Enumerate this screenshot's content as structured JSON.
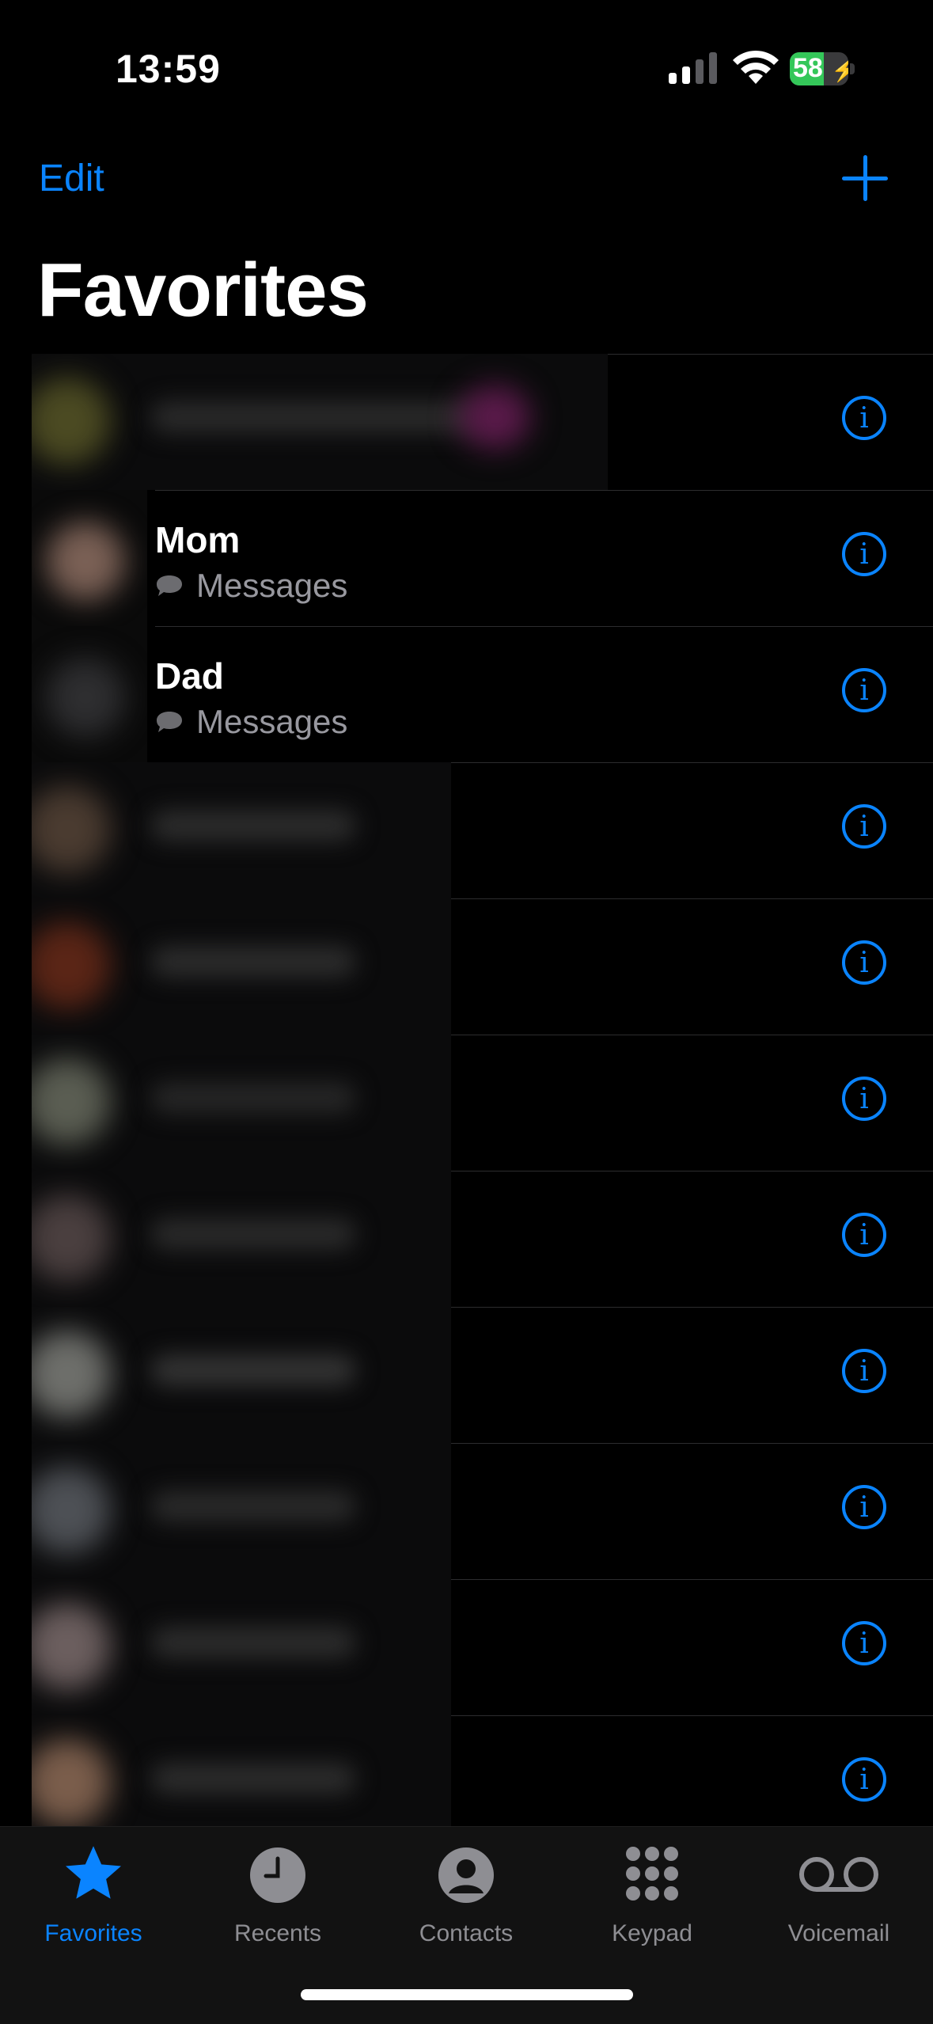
{
  "status_bar": {
    "time": "13:59",
    "battery_level": "58",
    "battery_percent_value": 58,
    "battery_color": "#34c759"
  },
  "header": {
    "edit_label": "Edit",
    "add_icon": "plus-icon",
    "title": "Favorites"
  },
  "accent_color": "#0a84ff",
  "favorites": [
    {
      "name": "",
      "subtitle": "",
      "blurred": true
    },
    {
      "name": "Mom",
      "subtitle": "Messages",
      "blurred": false
    },
    {
      "name": "Dad",
      "subtitle": "Messages",
      "blurred": false
    },
    {
      "name": "",
      "subtitle": "",
      "blurred": true
    },
    {
      "name": "",
      "subtitle": "",
      "blurred": true
    },
    {
      "name": "",
      "subtitle": "",
      "blurred": true
    },
    {
      "name": "",
      "subtitle": "",
      "blurred": true
    },
    {
      "name": "",
      "subtitle": "",
      "blurred": true
    },
    {
      "name": "",
      "subtitle": "",
      "blurred": true
    },
    {
      "name": "",
      "subtitle": "",
      "blurred": true
    },
    {
      "name": "",
      "subtitle": "",
      "blurred": true
    }
  ],
  "tab_bar": {
    "tabs": [
      {
        "label": "Favorites",
        "icon": "star-icon",
        "active": true
      },
      {
        "label": "Recents",
        "icon": "clock-icon",
        "active": false
      },
      {
        "label": "Contacts",
        "icon": "person-circle-icon",
        "active": false
      },
      {
        "label": "Keypad",
        "icon": "keypad-grid-icon",
        "active": false
      },
      {
        "label": "Voicemail",
        "icon": "voicemail-icon",
        "active": false
      }
    ]
  }
}
